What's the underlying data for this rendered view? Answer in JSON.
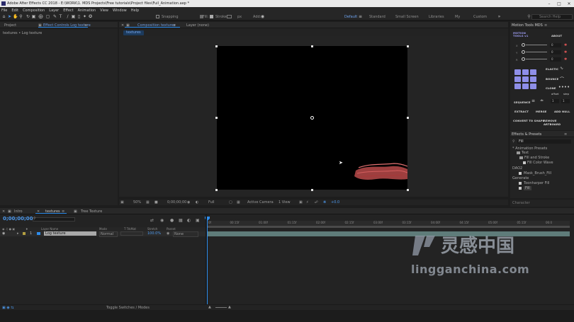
{
  "app": {
    "title": "Adobe After Effects CC 2018 - E:\\WORK\\1. MDS Projects\\Free tutorials\\Project files\\Fuil_Animation.aep *"
  },
  "menu": [
    "File",
    "Edit",
    "Composition",
    "Layer",
    "Effect",
    "Animation",
    "View",
    "Window",
    "Help"
  ],
  "toolbar": {
    "snapping": "Snapping",
    "fill": "Fill:",
    "stroke": "Stroke:",
    "stroke_px": "px",
    "add": "Add:",
    "workspaces": [
      "Default",
      "Standard",
      "Small Screen",
      "Libraries",
      "My",
      "Custom"
    ],
    "search_placeholder": "Search Help"
  },
  "project_panel": {
    "tab_project": "Project",
    "tab_effect_controls": "Effect Controls Log texture",
    "subtitle": "textures • Log texture"
  },
  "composition_panel": {
    "tab_comp": "Composition textures",
    "tab_layer": "Layer (none)",
    "crumb": "textures",
    "zoom": "50%",
    "timecode": "0;00;00;00",
    "resolution": "Full",
    "camera": "Active Camera",
    "views": "1 View",
    "offset": "+0.0"
  },
  "motion_tools": {
    "title": "Motion Tools MDS",
    "logo": "MOTION TOOLS v1",
    "about": "ABOUT",
    "fields": [
      "X",
      "Y",
      "R"
    ],
    "field_values": [
      "0",
      "0",
      "0"
    ],
    "elastic": "ELASTIC",
    "bounce": "BOUNCE",
    "clone": "CLONE",
    "offset": "offset",
    "step": "step",
    "sequence": "SEQUENCE",
    "step_values": [
      "1",
      "1"
    ],
    "extract": "EXTRACT",
    "merge": "MERGE",
    "add_null": "ADD NULL",
    "convert": "CONVERT TO SHAPE",
    "remove": "REMOVE ARTBOARD"
  },
  "effects_presets": {
    "title": "Effects & Presets",
    "search_value": "Fill",
    "items": [
      "* Animation Presets",
      "Text",
      "Fill and Stroke",
      "Fill Color Wave",
      "DAO2",
      "Mask_Brush_Fill",
      "Generate",
      "Toonharper Fill",
      "Fill"
    ],
    "character": "Character"
  },
  "timeline": {
    "tabs": [
      "Intro",
      "textures",
      "Tree Texture"
    ],
    "timecode": "0;00;00;00",
    "columns": [
      "Layer Name",
      "Mode",
      "T TrkMat",
      "Stretch",
      "Parent"
    ],
    "layer": {
      "index": "1",
      "name": "Log texture",
      "mode": "Normal",
      "stretch": "100.0%",
      "parent": "None"
    },
    "ruler": [
      "0f",
      "00:15f",
      "01:00f",
      "01:15f",
      "02:00f",
      "02:15f",
      "03:00f",
      "03:15f",
      "04:00f",
      "04:15f",
      "05:00f",
      "05:15f",
      "06:0"
    ],
    "toggle": "Toggle Switches / Modes"
  },
  "watermark": {
    "cn": "灵感中国",
    "url": "lingganchina.com"
  },
  "colors": {
    "accent": "#2d8ceb",
    "motion_tools": "#8e8ee8",
    "layer_bar": "#5f7c7a",
    "brush_red": "#c24b4b"
  }
}
